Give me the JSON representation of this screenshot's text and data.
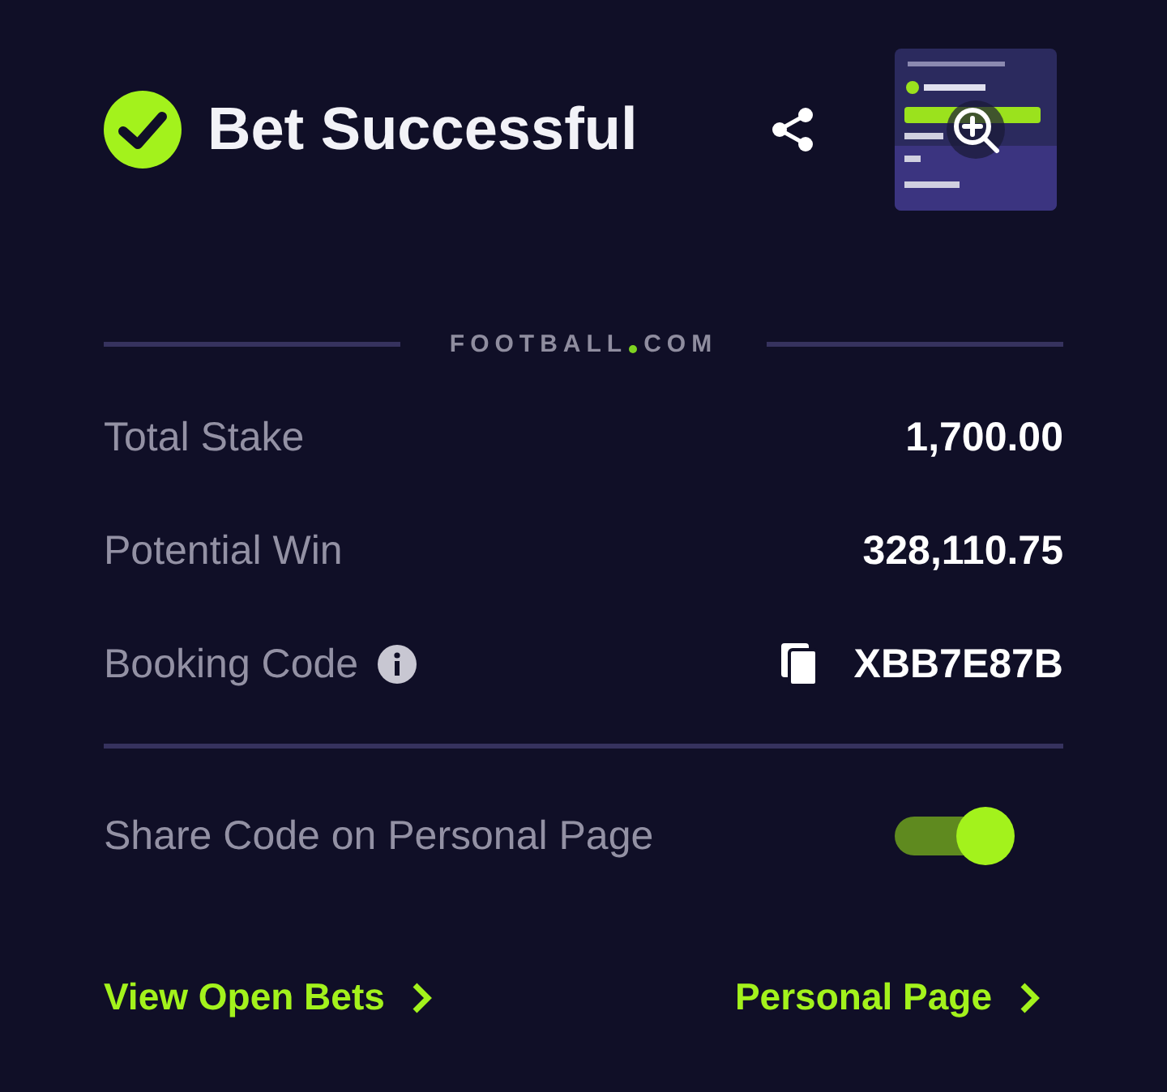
{
  "header": {
    "title": "Bet Successful"
  },
  "brand": {
    "name": "FOOTBALL",
    "suffix": "COM"
  },
  "details": [
    {
      "label": "Total Stake",
      "value": "1,700.00",
      "kind": "plain"
    },
    {
      "label": "Potential Win",
      "value": "328,110.75",
      "kind": "plain"
    },
    {
      "label": "Booking Code",
      "value": "XBB7E87B",
      "kind": "code"
    }
  ],
  "share_toggle": {
    "label": "Share Code on Personal Page",
    "on": true
  },
  "links": [
    {
      "label": "View Open Bets"
    },
    {
      "label": "Personal Page"
    }
  ]
}
